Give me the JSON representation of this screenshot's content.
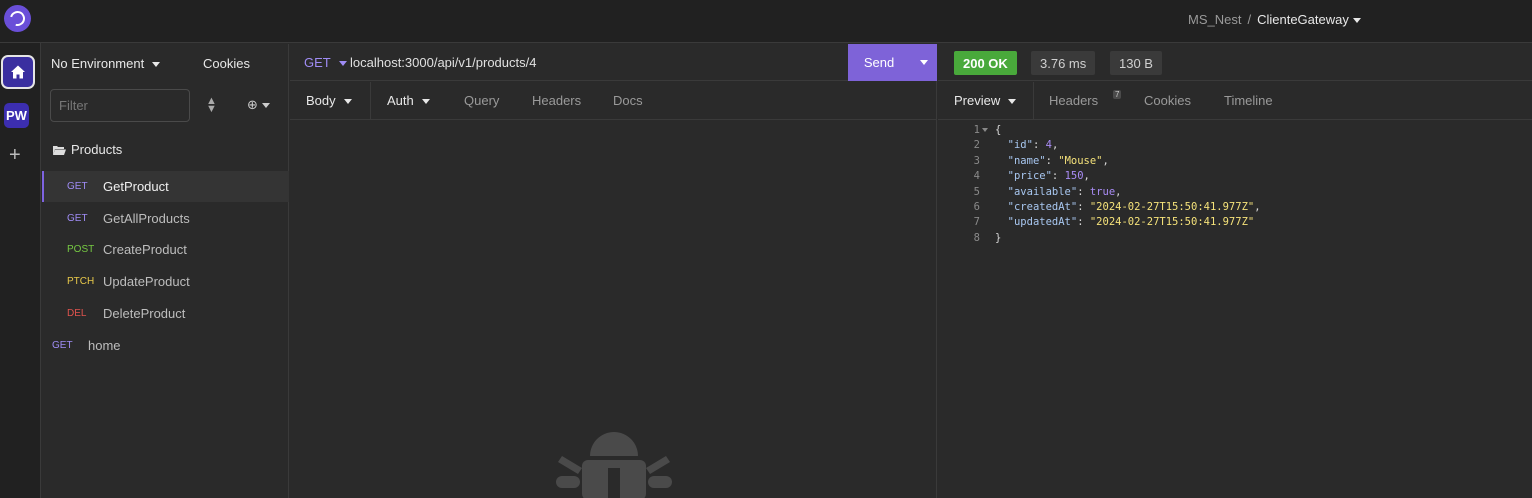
{
  "header": {
    "project": "MS_Nest",
    "separator": "/",
    "collection": "ClienteGateway"
  },
  "rail": {
    "pw_label": "PW",
    "add_label": "+"
  },
  "sidebar": {
    "environment": "No Environment",
    "cookies": "Cookies",
    "filter_placeholder": "Filter",
    "folder": "Products",
    "requests": [
      {
        "method": "GET",
        "name": "GetProduct"
      },
      {
        "method": "GET",
        "name": "GetAllProducts"
      },
      {
        "method": "POST",
        "name": "CreateProduct"
      },
      {
        "method": "PTCH",
        "name": "UpdateProduct"
      },
      {
        "method": "DEL",
        "name": "DeleteProduct"
      }
    ],
    "root_request": {
      "method": "GET",
      "name": "home"
    }
  },
  "request": {
    "method": "GET",
    "url": "localhost:3000/api/v1/products/4",
    "send_label": "Send",
    "tabs": [
      "Body",
      "Auth",
      "Query",
      "Headers",
      "Docs"
    ]
  },
  "response": {
    "status": "200 OK",
    "time": "3.76 ms",
    "size": "130 B",
    "tabs": [
      "Preview",
      "Headers",
      "Cookies",
      "Timeline"
    ],
    "headers_count": "7",
    "lines": [
      {
        "num": "1",
        "text": "{"
      },
      {
        "num": "2",
        "key": "\"id\"",
        "value": "4",
        "type": "number",
        "comma": ","
      },
      {
        "num": "3",
        "key": "\"name\"",
        "value": "\"Mouse\"",
        "type": "string",
        "comma": ","
      },
      {
        "num": "4",
        "key": "\"price\"",
        "value": "150",
        "type": "number",
        "comma": ","
      },
      {
        "num": "5",
        "key": "\"available\"",
        "value": "true",
        "type": "bool",
        "comma": ","
      },
      {
        "num": "6",
        "key": "\"createdAt\"",
        "value": "\"2024-02-27T15:50:41.977Z\"",
        "type": "string",
        "comma": ","
      },
      {
        "num": "7",
        "key": "\"updatedAt\"",
        "value": "\"2024-02-27T15:50:41.977Z\"",
        "type": "string",
        "comma": ""
      },
      {
        "num": "8",
        "text": "}"
      }
    ]
  }
}
